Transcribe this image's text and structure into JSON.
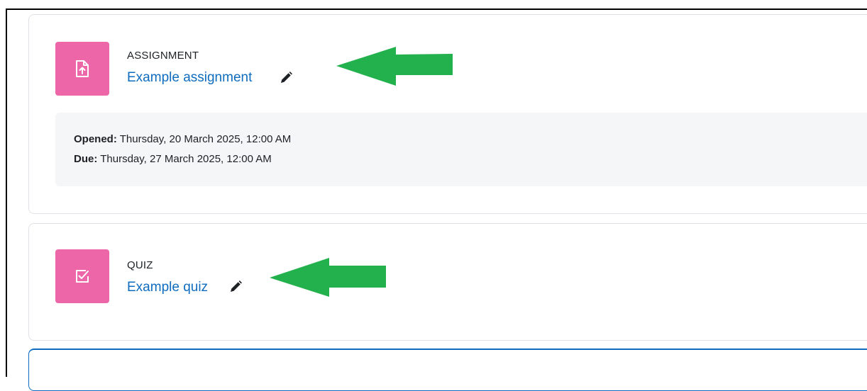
{
  "activities": [
    {
      "type_label": "ASSIGNMENT",
      "name": "Example assignment",
      "icon": "assignment-upload-icon",
      "dates": [
        {
          "label": "Opened:",
          "value": "Thursday, 20 March 2025, 12:00 AM"
        },
        {
          "label": "Due:",
          "value": "Thursday, 27 March 2025, 12:00 AM"
        }
      ]
    },
    {
      "type_label": "QUIZ",
      "name": "Example quiz",
      "icon": "quiz-checkbox-icon"
    }
  ],
  "colors": {
    "icon_tile": "#ec66a8",
    "link": "#0f6cbf",
    "annotation_arrow": "#22b14c",
    "dates_panel": "#f5f6f8"
  }
}
